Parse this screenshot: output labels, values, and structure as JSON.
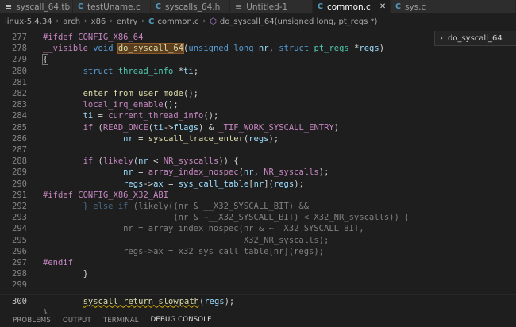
{
  "tabs": [
    {
      "label": "syscall_64.tbl",
      "icon": "table-icon",
      "active": false
    },
    {
      "label": "testUname.c",
      "icon": "c-file-icon",
      "active": false
    },
    {
      "label": "syscalls_64.h",
      "icon": "c-file-icon",
      "active": false
    },
    {
      "label": "Untitled-1",
      "icon": "untitled-file-icon",
      "active": false
    },
    {
      "label": "common.c",
      "icon": "c-file-icon",
      "active": true
    },
    {
      "label": "sys.c",
      "icon": "c-file-icon",
      "active": false
    }
  ],
  "breadcrumb": {
    "items": [
      "linux-5.4.34",
      "arch",
      "x86",
      "entry",
      "common.c",
      "do_syscall_64(unsigned long, pt_regs *)"
    ]
  },
  "outline": {
    "label": "do_syscall_64"
  },
  "editor": {
    "line_numbers": [
      "277",
      "278",
      "279",
      "280",
      "281",
      "282",
      "283",
      "284",
      "285",
      "286",
      "287",
      "288",
      "289",
      "290",
      "291",
      "292",
      "293",
      "294",
      "295",
      "296",
      "297",
      "298",
      "299",
      "300"
    ],
    "current_line": "300"
  },
  "panel": {
    "tabs": [
      "PROBLEMS",
      "OUTPUT",
      "TERMINAL",
      "DEBUG CONSOLE"
    ],
    "active": "DEBUG CONSOLE"
  },
  "colors": {
    "background": "#1e1e1e",
    "keyword": "#569cd6",
    "control": "#c586c0",
    "function": "#dcdcaa",
    "variable": "#9cdcfe",
    "type": "#4ec9b0",
    "inactive": "#808080"
  }
}
